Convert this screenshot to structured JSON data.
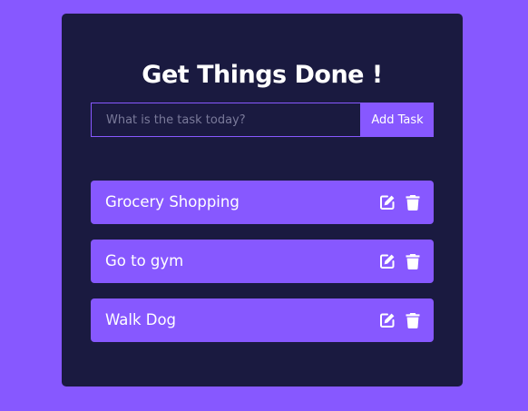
{
  "header": {
    "title": "Get Things Done !"
  },
  "form": {
    "placeholder": "What is the task today?",
    "value": "",
    "button_label": "Add Task"
  },
  "todos": [
    {
      "text": "Grocery Shopping",
      "icons": [
        "edit-icon",
        "trash-icon"
      ]
    },
    {
      "text": "Go to gym",
      "icons": [
        "edit-icon",
        "trash-icon"
      ]
    },
    {
      "text": "Walk Dog",
      "icons": [
        "edit-icon",
        "trash-icon"
      ]
    }
  ],
  "colors": {
    "background": "#8758ff",
    "card": "#1a1a40",
    "accent": "#8758ff",
    "text": "#ffffff"
  }
}
